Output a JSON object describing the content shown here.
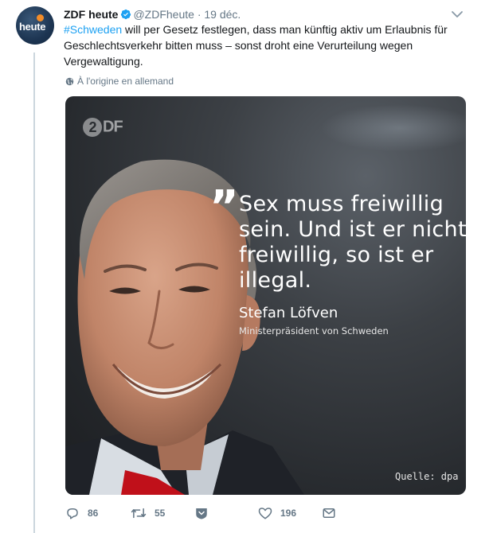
{
  "tweet": {
    "author": {
      "name": "ZDF heute",
      "handle": "@ZDFheute",
      "avatar_text": "heute",
      "verified_icon": "verified-badge-icon"
    },
    "separator": "·",
    "date": "19 déc.",
    "text": {
      "hashtag": "#Schweden",
      "body": " will per Gesetz festlegen, dass man künftig aktiv um Erlaubnis  für Geschlechtsverkehr bitten muss – sonst droht eine Verurteilung wegen Vergewaltigung."
    },
    "translation_label": "À l'origine en allemand",
    "media": {
      "logo_text": "DF",
      "logo_badge": "2",
      "quote_mark": "”",
      "quote_lines": [
        "Sex muss freiwillig",
        "sein. Und ist er nicht",
        "freiwillig, so ist er",
        "illegal."
      ],
      "author": "Stefan Löfven",
      "role": "Ministerpräsident von Schweden",
      "source": "Quelle: dpa"
    },
    "actions": {
      "replies": "86",
      "retweets": "55",
      "likes": "196"
    }
  },
  "colors": {
    "link": "#1da1f2",
    "muted": "#657786",
    "thread_line": "#ccd6dd"
  }
}
